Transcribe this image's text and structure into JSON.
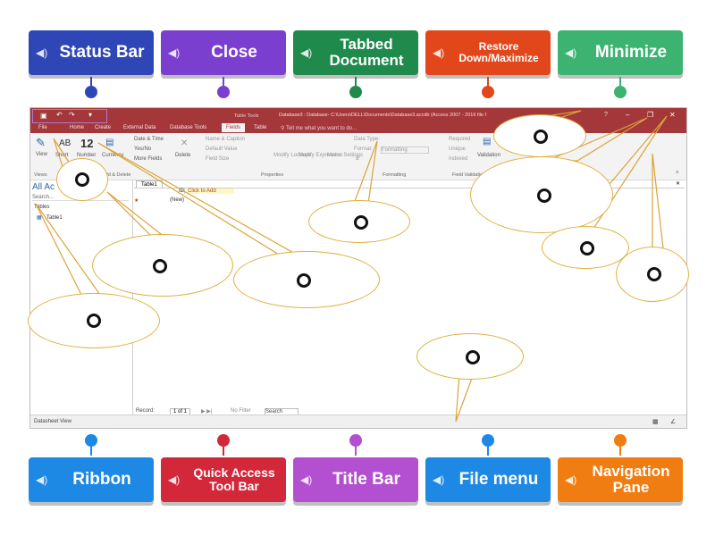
{
  "tiles_top": [
    {
      "label": "Status Bar",
      "color": "#2f47b6",
      "pin": "#2f47b6"
    },
    {
      "label": "Close",
      "color": "#7b3fd0",
      "pin": "#7b3fd0"
    },
    {
      "label": "Tabbed Document",
      "color": "#1f8a4c",
      "pin": "#1f8a4c"
    },
    {
      "label": "Restore Down/Maximize",
      "color": "#e2471c",
      "pin": "#e2471c"
    },
    {
      "label": "Minimize",
      "color": "#3cb371",
      "pin": "#3cb371"
    }
  ],
  "tiles_bottom": [
    {
      "label": "Ribbon",
      "color": "#1e88e5",
      "pin": "#1e88e5"
    },
    {
      "label": "Quick Access Tool Bar",
      "color": "#d2283a",
      "pin": "#d2283a"
    },
    {
      "label": "Title Bar",
      "color": "#b34fd1",
      "pin": "#b34fd1"
    },
    {
      "label": "File menu",
      "color": "#1e88e5",
      "pin": "#1e88e5"
    },
    {
      "label": "Navigation Pane",
      "color": "#f07d11",
      "pin": "#f07d11"
    }
  ],
  "access": {
    "title_context": "Table Tools",
    "title": "Database3 : Database- C:\\Users\\DELL\\Documents\\Database3.accdb (Access 2007 - 2016 file f",
    "help": "?",
    "tabs": [
      "File",
      "Home",
      "Create",
      "External Data",
      "Database Tools",
      "Fields",
      "Table"
    ],
    "tell_me": "Tell me what you want to do...",
    "ribbon": {
      "view": "View",
      "ab": "AB",
      "num12": "12",
      "short_text": "Short",
      "number": "Number",
      "currency": "Currency",
      "date_time": "Date & Time",
      "yes_no": "Yes/No",
      "more_fields": "More Fields",
      "delete": "Delete",
      "name_caption": "Name & Caption",
      "default_value": "Default Value",
      "field_size": "Field Size",
      "modify_lookups": "Modify Lookups",
      "modify_expression": "Modify Expression",
      "memo_settings": "Memo Settings",
      "data_type": "Data Type:",
      "format": "Format:",
      "formatting": "Formatting",
      "dollar": "$",
      "percent": "%",
      "comma": "9",
      "required": "Required",
      "unique": "Unique",
      "indexed": "Indexed",
      "validation": "Validation",
      "groups": [
        "Views",
        "Add & Delete",
        "Properties",
        "Formatting",
        "Field Validation"
      ]
    },
    "nav": {
      "header": "All Ac",
      "search": "Search...",
      "section": "Tables",
      "item": "Table1"
    },
    "doc": {
      "tab": "Table1",
      "col_id": "ID",
      "col_add": "Click to Add",
      "new_row": "(New)"
    },
    "record_nav": {
      "label": "Record:",
      "position": "1 of 1",
      "filter": "No Filter",
      "search": "Search"
    },
    "status_text": "Datasheet View"
  }
}
